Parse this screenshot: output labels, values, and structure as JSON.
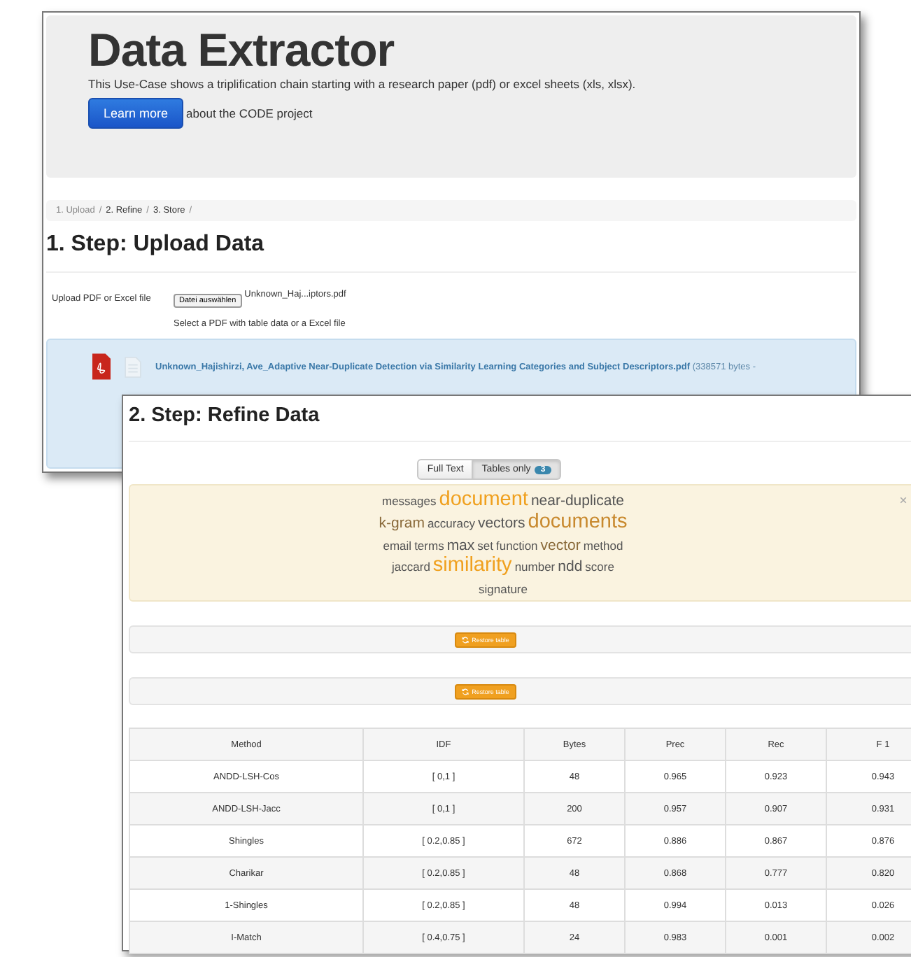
{
  "upload_window": {
    "header": {
      "title": "Data Extractor",
      "description": "This Use-Case shows a triplification chain starting with a research paper (pdf) or excel sheets (xls, xlsx).",
      "button": "Learn more",
      "button_note": "about the CODE project"
    },
    "breadcrumb": {
      "separator": "/",
      "items": [
        {
          "label": "1. Upload",
          "selected": true
        },
        {
          "label": "2. Refine",
          "selected": false
        },
        {
          "label": "3. Store",
          "selected": false
        }
      ]
    },
    "heading": "1. Step: Upload Data",
    "upload": {
      "label": "Upload PDF or Excel file",
      "button": "Datei auswählen",
      "file_name": "Unknown_Haj...iptors.pdf",
      "help": "Select a PDF with table data or a Excel file"
    },
    "file": {
      "name": "Unknown_Hajishirzi, Ave_Adaptive Near-Duplicate Detection via Similarity Learning Categories and Subject Descriptors.pdf",
      "size": "(338571 bytes -"
    }
  },
  "refine_window": {
    "heading": "2. Step: Refine Data",
    "toggle": [
      {
        "label": "Full Text",
        "selected": false
      },
      {
        "label": "Tables only",
        "selected": true,
        "badge": "3"
      }
    ],
    "word_cloud": [
      {
        "text": "messages",
        "kind": "small",
        "color": "#555555"
      },
      {
        "text": "document",
        "kind": "large",
        "color": "#f0a01e"
      },
      {
        "text": "near-duplicate",
        "kind": "medium",
        "color": "#555555"
      },
      {
        "text": "k-gram",
        "kind": "medium",
        "color": "#8a6a3a"
      },
      {
        "text": "accuracy",
        "kind": "small",
        "color": "#555555"
      },
      {
        "text": "vectors",
        "kind": "medium",
        "color": "#555555"
      },
      {
        "text": "documents",
        "kind": "large",
        "color": "#c8892e"
      },
      {
        "text": "email",
        "kind": "small",
        "color": "#555555"
      },
      {
        "text": "terms",
        "kind": "small",
        "color": "#555555"
      },
      {
        "text": "max",
        "kind": "medium",
        "color": "#555555"
      },
      {
        "text": "set",
        "kind": "small",
        "color": "#555555"
      },
      {
        "text": "function",
        "kind": "small",
        "color": "#555555"
      },
      {
        "text": "vector",
        "kind": "medium",
        "color": "#8a6a3a"
      },
      {
        "text": "method",
        "kind": "small",
        "color": "#555555"
      },
      {
        "text": "jaccard",
        "kind": "small",
        "color": "#555555"
      },
      {
        "text": "similarity",
        "kind": "large",
        "color": "#f0a01e"
      },
      {
        "text": "number",
        "kind": "small",
        "color": "#555555"
      },
      {
        "text": "ndd",
        "kind": "medium",
        "color": "#555555"
      },
      {
        "text": "score",
        "kind": "small",
        "color": "#555555"
      },
      {
        "text": "signature",
        "kind": "small",
        "color": "#555555"
      }
    ],
    "restore_buttons": [
      "Restore table",
      "Restore table"
    ],
    "table": {
      "columns": [
        "Method",
        "IDF",
        "Bytes",
        "Prec",
        "Rec",
        "F 1"
      ],
      "rows": [
        [
          "ANDD-LSH-Cos",
          "[ 0,1 ]",
          "48",
          "0.965",
          "0.923",
          "0.943"
        ],
        [
          "ANDD-LSH-Jacc",
          "[ 0,1 ]",
          "200",
          "0.957",
          "0.907",
          "0.931"
        ],
        [
          "Shingles",
          "[ 0.2,0.85 ]",
          "672",
          "0.886",
          "0.867",
          "0.876"
        ],
        [
          "Charikar",
          "[ 0.2,0.85 ]",
          "48",
          "0.868",
          "0.777",
          "0.820"
        ],
        [
          "1-Shingles",
          "[ 0.2,0.85 ]",
          "48",
          "0.994",
          "0.013",
          "0.026"
        ],
        [
          "I-Match",
          "[ 0.4,0.75 ]",
          "24",
          "0.983",
          "0.001",
          "0.002"
        ]
      ]
    }
  }
}
